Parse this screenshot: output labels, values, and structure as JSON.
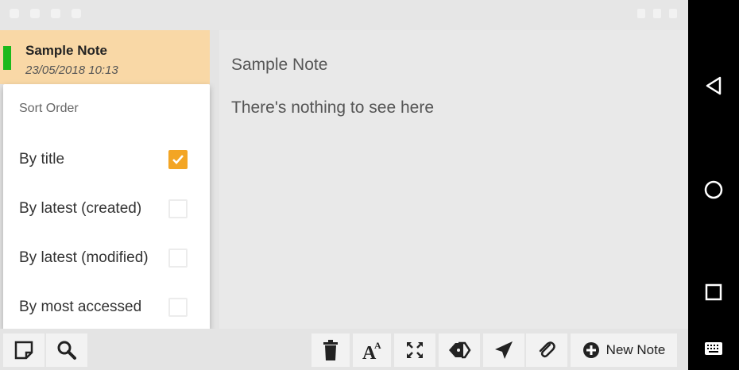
{
  "note_list": {
    "items": [
      {
        "title": "Sample Note",
        "date": "23/05/2018 10:13"
      }
    ]
  },
  "editor": {
    "title": "Sample Note",
    "body": "There's nothing to see here"
  },
  "sort_menu": {
    "heading": "Sort Order",
    "options": [
      {
        "label": "By title",
        "checked": true
      },
      {
        "label": "By latest (created)",
        "checked": false
      },
      {
        "label": "By latest (modified)",
        "checked": false
      },
      {
        "label": "By most accessed",
        "checked": false
      }
    ]
  },
  "toolbar": {
    "new_note_label": "New Note",
    "icons": [
      "new-note-square-icon",
      "search-icon",
      "trash-icon",
      "text-size-icon",
      "fullscreen-icon",
      "tag-icon",
      "send-icon",
      "attach-icon",
      "plus-circle-icon"
    ]
  },
  "navigation": {
    "icons": [
      "back-icon",
      "home-icon",
      "recents-icon",
      "keyboard-icon"
    ]
  },
  "colors": {
    "note_highlight": "#f9d8a6",
    "note_indicator": "#1bb91b",
    "checkbox_checked": "#f3a524"
  }
}
